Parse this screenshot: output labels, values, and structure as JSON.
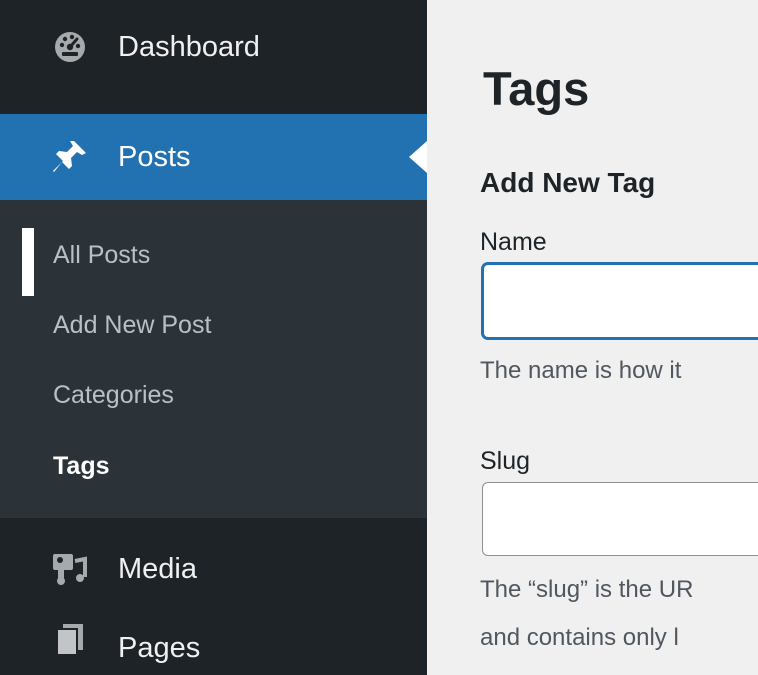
{
  "sidebar": {
    "dashboard": {
      "label": "Dashboard",
      "icon": "dashboard-gauge-icon"
    },
    "posts": {
      "label": "Posts",
      "icon": "pushpin-icon"
    },
    "submenu": {
      "all_posts": "All Posts",
      "add_new_post": "Add New Post",
      "categories": "Categories",
      "tags": "Tags"
    },
    "media": {
      "label": "Media",
      "icon": "media-icon"
    },
    "pages": {
      "label": "Pages",
      "icon": "pages-icon"
    }
  },
  "main": {
    "page_title": "Tags",
    "form_heading": "Add New Tag",
    "name_field": {
      "label": "Name",
      "value": "",
      "help": "The name is how it"
    },
    "slug_field": {
      "label": "Slug",
      "value": "",
      "help_line1": "The “slug” is the UR",
      "help_line2": "and contains only l"
    }
  },
  "colors": {
    "sidebar_bg": "#1d2327",
    "submenu_bg": "#2c3338",
    "accent": "#2271b1",
    "content_bg": "#f0f0f1"
  }
}
